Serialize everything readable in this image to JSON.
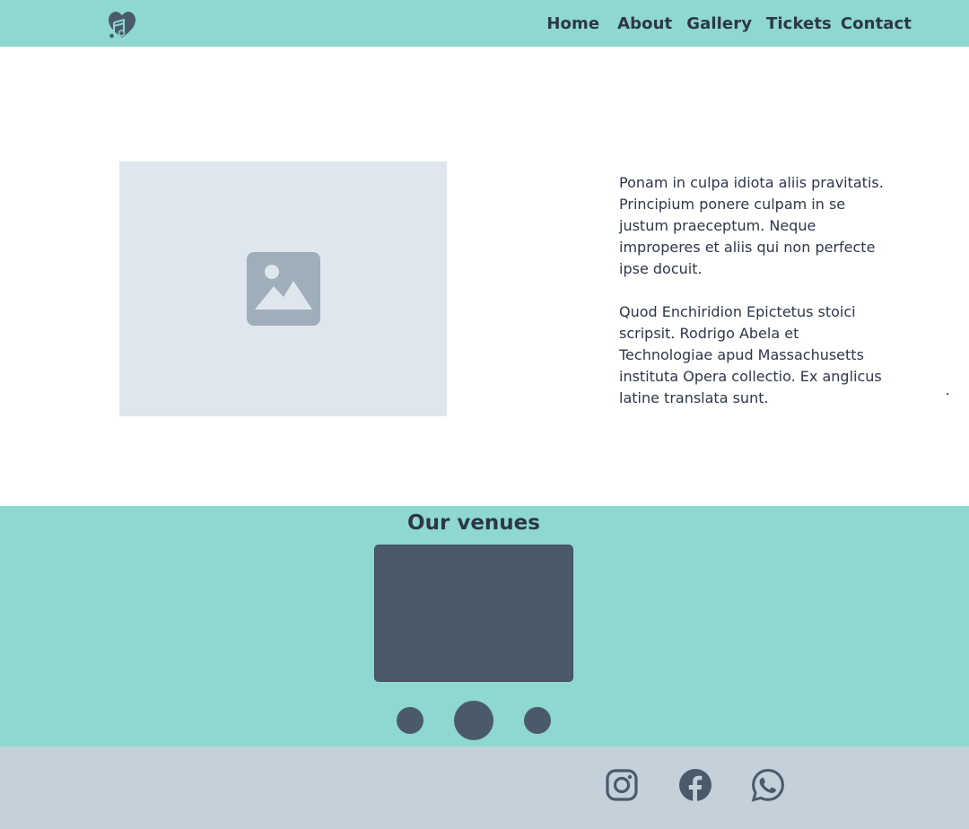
{
  "header": {
    "logo_icon": "music-heart-icon",
    "nav": [
      {
        "label": "Home"
      },
      {
        "label": "About"
      },
      {
        "label": "Gallery"
      },
      {
        "label": "Tickets"
      },
      {
        "label": "Contact"
      }
    ]
  },
  "hero": {
    "image_icon": "image-placeholder-icon",
    "paragraphs": [
      "Ponam in culpa idiota aliis pravitatis. Principium ponere culpam in se justum praeceptum. Neque improperes et aliis qui non perfecte ipse docuit.",
      "Quod Enchiridion Epictetus stoici scripsit. Rodrigo Abela et Technologiae apud Massachusetts instituta Opera collectio. Ex anglicus latine translata sunt."
    ]
  },
  "venues": {
    "title": "Our venues",
    "slides": 3,
    "active_slide": 2
  },
  "footer": {
    "social": [
      {
        "icon": "instagram-icon"
      },
      {
        "icon": "facebook-icon"
      },
      {
        "icon": "whatsapp-icon"
      }
    ]
  },
  "colors": {
    "teal": "#8ed8cf",
    "dark": "#4a5a6a",
    "text": "#2d3748",
    "placeholder_bg": "#e0e6ee",
    "footer_bg": "#c4d0da"
  }
}
